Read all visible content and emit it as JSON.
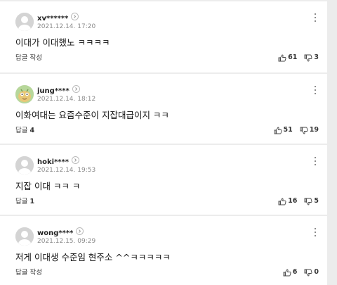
{
  "comments": [
    {
      "username": "xv******",
      "date": "2021.12.14. 17:20",
      "text": "이대가 이대했노 ㅋㅋㅋㅋ",
      "reply_label": "답글 작성",
      "reply_count": "",
      "likes": "61",
      "dislikes": "3",
      "avatar": "default-avatar"
    },
    {
      "username": "jung****",
      "date": "2021.12.14. 18:12",
      "text": "이화여대는 요즘수준이 지잡대급이지 ㅋㅋ",
      "reply_label": "답글",
      "reply_count": "4",
      "likes": "51",
      "dislikes": "19",
      "avatar": "character-avatar"
    },
    {
      "username": "hoki****",
      "date": "2021.12.14. 19:53",
      "text": "지잡 이대 ㅋㅋ ㅋ",
      "reply_label": "답글",
      "reply_count": "1",
      "likes": "16",
      "dislikes": "5",
      "avatar": "default-avatar"
    },
    {
      "username": "wong****",
      "date": "2021.12.15. 09:29",
      "text": "저게 이대생 수준임 현주소 ^^ㅋㅋㅋㅋㅋ",
      "reply_label": "답글 작성",
      "reply_count": "",
      "likes": "6",
      "dislikes": "0",
      "avatar": "default-avatar"
    }
  ],
  "icons": {
    "like": "thumbs-up-icon",
    "dislike": "thumbs-down-icon",
    "more": "kebab-menu-icon",
    "profile": "chevron-right-icon"
  },
  "colors": {
    "background": "#ececec",
    "card": "#ffffff",
    "text": "#111111",
    "meta": "#8a8a8a"
  }
}
